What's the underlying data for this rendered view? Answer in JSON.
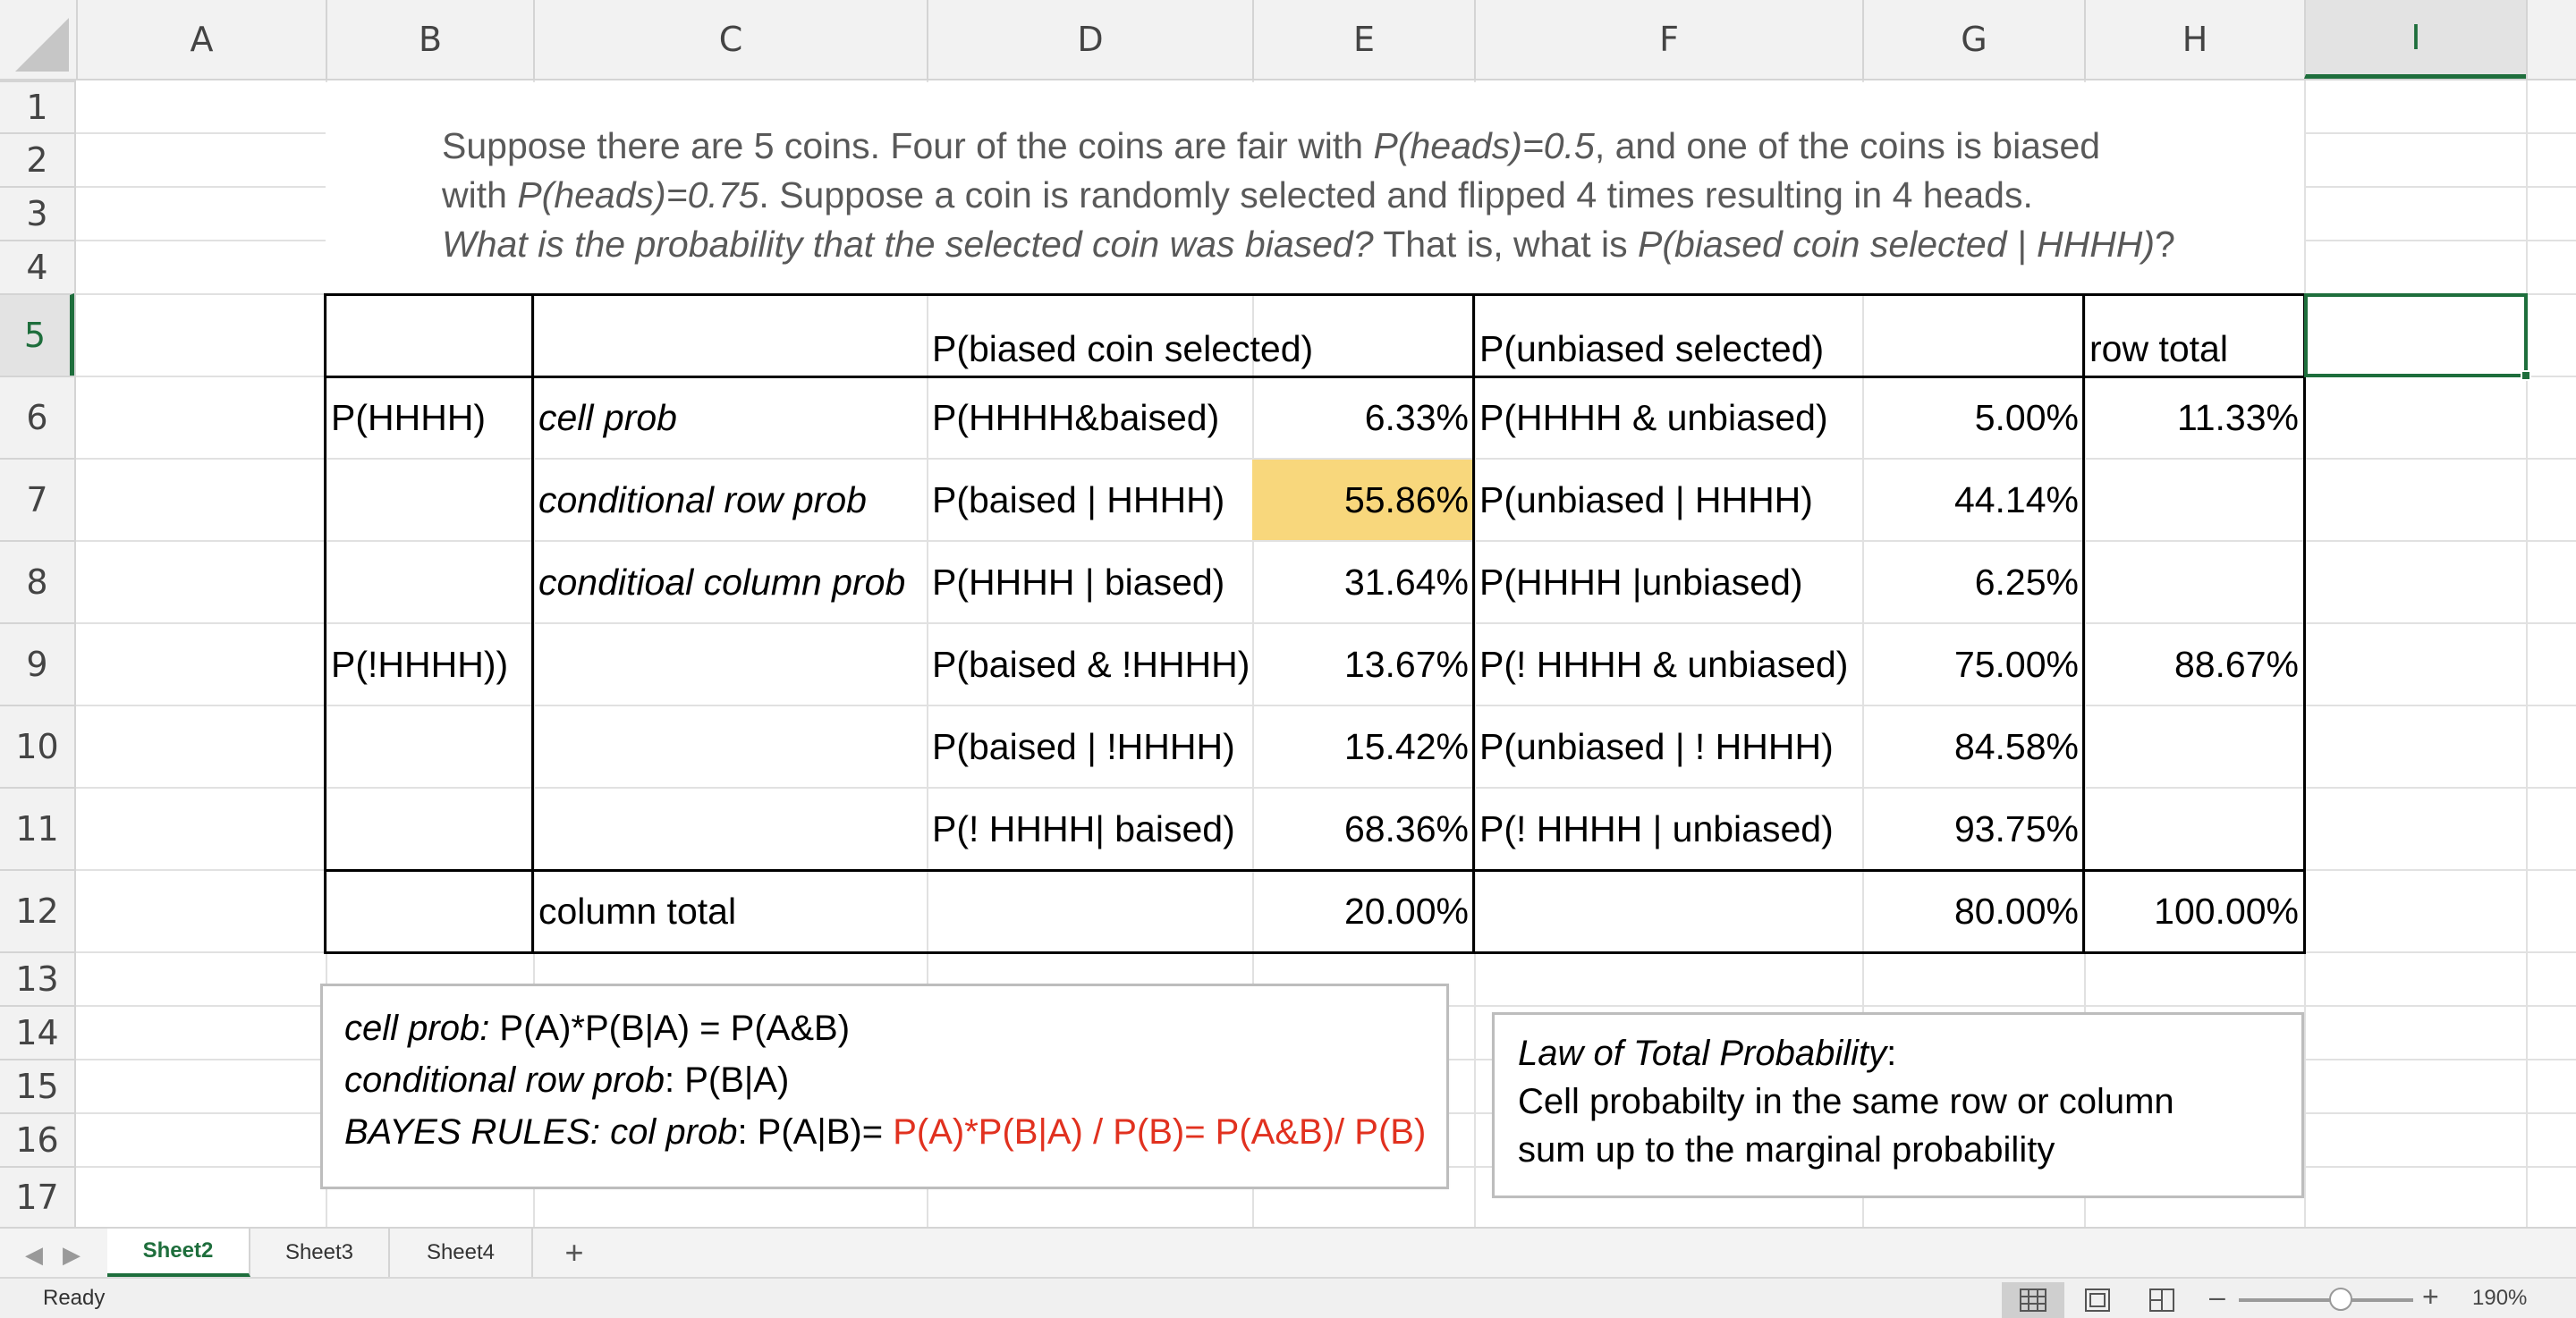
{
  "columns": [
    "A",
    "B",
    "C",
    "D",
    "E",
    "F",
    "G",
    "H",
    "I"
  ],
  "rows": [
    "1",
    "2",
    "3",
    "4",
    "5",
    "6",
    "7",
    "8",
    "9",
    "10",
    "11",
    "12",
    "13",
    "14",
    "15",
    "16",
    "17"
  ],
  "intro": {
    "line1_a": "Suppose there are 5 coins. Four of the coins are fair with ",
    "line1_b": "P(heads)=0.5",
    "line1_c": ", and one of the coins is biased",
    "line2_a": "with ",
    "line2_b": "P(heads)=0.75",
    "line2_c": ". Suppose a coin is randomly selected and flipped 4 times resulting in 4 heads.",
    "line3_a": "What is the probability that the selected coin was biased?",
    "line3_b": " That is, what is ",
    "line3_c": "P(biased coin selected | HHHH)",
    "line3_d": "?"
  },
  "table": {
    "D5": "P(biased coin selected)",
    "F5": "P(unbiased selected)",
    "H5": "row total",
    "B6": "P(HHHH)",
    "C6": "cell prob",
    "D6": "P(HHHH&baised)",
    "E6": "6.33%",
    "F6": "P(HHHH & unbiased)",
    "G6": "5.00%",
    "H6": "11.33%",
    "C7": "conditional row prob",
    "D7": "P(baised | HHHH)",
    "E7": "55.86%",
    "F7": "P(unbiased | HHHH)",
    "G7": "44.14%",
    "C8": "conditioal column prob",
    "D8": "P(HHHH | biased)",
    "E8": "31.64%",
    "F8": "P(HHHH |unbiased)",
    "G8": "6.25%",
    "B9": "P(!HHHH))",
    "D9": "P(baised & !HHHH)",
    "E9": "13.67%",
    "F9": "P(! HHHH & unbiased)",
    "G9": "75.00%",
    "H9": "88.67%",
    "D10": "P(baised | !HHHH)",
    "E10": "15.42%",
    "F10": "P(unbiased | ! HHHH)",
    "G10": "84.58%",
    "D11": "P(! HHHH| baised)",
    "E11": "68.36%",
    "F11": "P(! HHHH | unbiased)",
    "G11": "93.75%",
    "C12": "column total",
    "E12": "20.00%",
    "G12": "80.00%",
    "H12": "100.00%"
  },
  "box1": {
    "l1_label": "cell prob:",
    "l1_text": " P(A)*P(B|A) = P(A&B)",
    "l2_label": "conditional row prob",
    "l2_text": ": P(B|A)",
    "l3_label": "BAYES RULES: col prob",
    "l3_text": ": P(A|B)= ",
    "l3_red": "P(A)*P(B|A) / P(B)= P(A&B)/ P(B)"
  },
  "box2": {
    "title": "Law of Total Probability",
    "colon": ":",
    "l2": "Cell probabilty in the same row or column",
    "l3": "sum up to the marginal probability"
  },
  "sheets": [
    "Sheet2",
    "Sheet3",
    "Sheet4"
  ],
  "add_sheet": "+",
  "status": "Ready",
  "zoom": {
    "minus": "–",
    "plus": "+",
    "level": "190%"
  },
  "colors": {
    "accent": "#1e6e3c",
    "highlight": "#f8d77c",
    "red_text": "#e1311f"
  },
  "icons": [
    "scroll-left-icon",
    "scroll-right-icon",
    "normal-view-icon",
    "page-layout-icon",
    "page-break-icon"
  ]
}
